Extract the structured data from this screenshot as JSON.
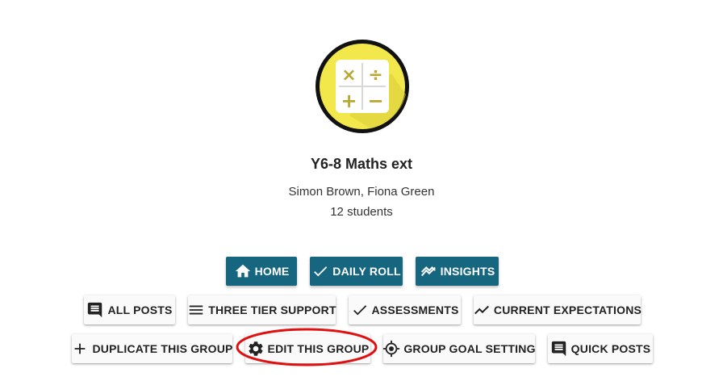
{
  "group": {
    "title": "Y6-8 Maths ext",
    "teachers": "Simon Brown, Fiona Green",
    "students": "12 students",
    "avatar": {
      "icon": "calculator-icon",
      "symbols": [
        "×",
        "÷",
        "+",
        "−"
      ],
      "colors": {
        "ring": "#111111",
        "fill": "#f2e84b",
        "tile": "#ffffff",
        "symbol": "#b9a732"
      }
    }
  },
  "primary_actions": [
    {
      "label": "HOME",
      "icon": "home-icon"
    },
    {
      "label": "DAILY ROLL",
      "icon": "check-icon"
    },
    {
      "label": "INSIGHTS",
      "icon": "insights-icon"
    }
  ],
  "secondary_actions_row1": [
    {
      "label": "ALL POSTS",
      "icon": "comment-icon"
    },
    {
      "label": "THREE TIER SUPPORT",
      "icon": "menu-icon"
    },
    {
      "label": "ASSESSMENTS",
      "icon": "check-icon"
    },
    {
      "label": "CURRENT EXPECTATIONS",
      "icon": "trending-icon"
    }
  ],
  "secondary_actions_row2": [
    {
      "label": "DUPLICATE THIS GROUP",
      "icon": "plus-icon"
    },
    {
      "label": "EDIT THIS GROUP",
      "icon": "gear-icon"
    },
    {
      "label": "GROUP GOAL SETTING",
      "icon": "target-icon"
    },
    {
      "label": "QUICK POSTS",
      "icon": "comment-icon"
    }
  ],
  "colors": {
    "primary": "#17667f",
    "highlight": "#e01010"
  }
}
